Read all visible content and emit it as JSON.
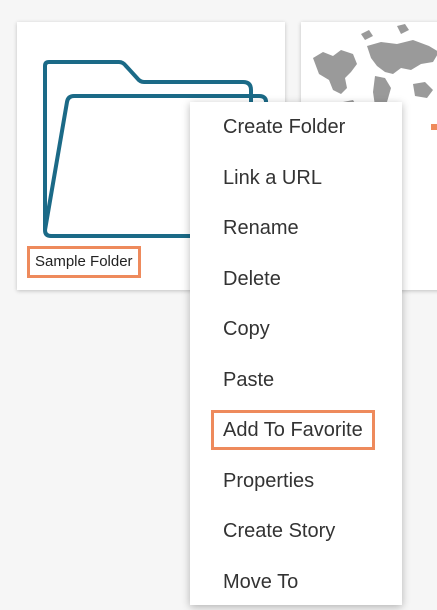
{
  "folder": {
    "name": "Sample Folder",
    "icon": "folder-icon",
    "stroke_color": "#1b6a87"
  },
  "map_tile": {
    "icon": "world-map-icon",
    "color": "#9a9a9a"
  },
  "context_menu": {
    "items": [
      {
        "label": "Create Folder"
      },
      {
        "label": "Link a URL"
      },
      {
        "label": "Rename"
      },
      {
        "label": "Delete"
      },
      {
        "label": "Copy"
      },
      {
        "label": "Paste"
      },
      {
        "label": "Add To Favorite",
        "highlighted": true
      },
      {
        "label": "Properties"
      },
      {
        "label": "Create Story"
      },
      {
        "label": "Move To"
      }
    ]
  },
  "colors": {
    "highlight_border": "#ee8a5c",
    "background": "#f6f6f6"
  }
}
